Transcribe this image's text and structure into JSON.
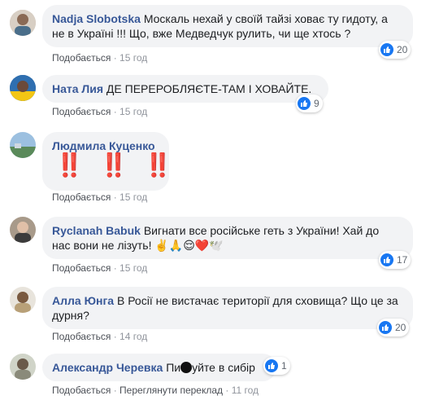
{
  "like_label": "Подобається",
  "comments": [
    {
      "author": "Nadja Slobotska",
      "text1": "Москаль нехай у своїй тайзі ховає ту гидоту, а",
      "text2": "не в Україні !!! Що, вже Медведчук рулить, чи ще хтось ?",
      "time": "15 год",
      "reactions": "20"
    },
    {
      "author": "Ната Лия",
      "text1": "ДЕ ПЕРЕРОБЛЯЄТЕ-ТАМ І ХОВАЙТЕ.",
      "time": "15 год",
      "reactions": "9"
    },
    {
      "author": "Людмила Куценко",
      "text1": "‼️ ‼️ ‼️",
      "time": "15 год"
    },
    {
      "author": "Ryclanah Babuk",
      "text1": "Вигнати все російське геть з України! Хай до",
      "text2": "нас вони не лізуть! ✌️🙏😌❤️🕊️",
      "time": "15 год",
      "reactions": "17"
    },
    {
      "author": "Алла Юнга",
      "text1": "В Росії не вистачає території для сховища? Що це за",
      "text2": "дурня?",
      "time": "14 год",
      "reactions": "20"
    },
    {
      "author": "Александр Черевка",
      "text_pre": "Пи",
      "text_post": "уйте в сибір",
      "time": "11 год",
      "translate": "Переглянути переклад",
      "reactions": "1"
    }
  ]
}
